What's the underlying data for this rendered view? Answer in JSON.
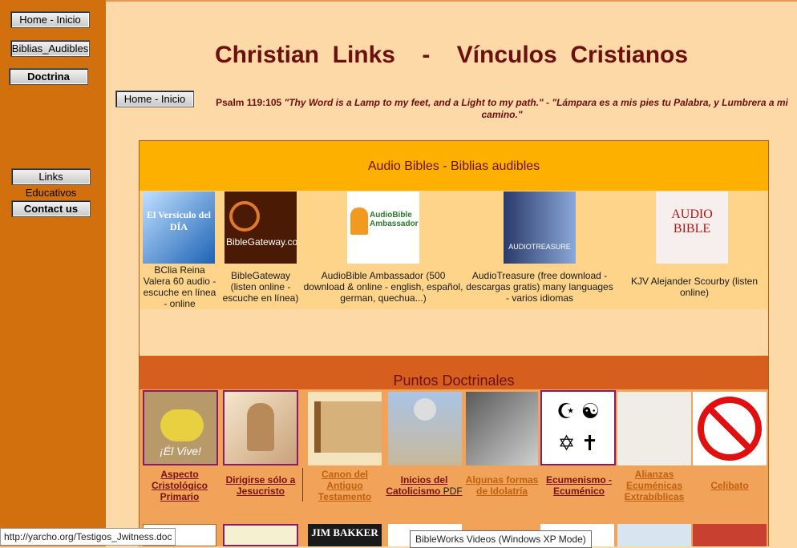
{
  "sidebar": {
    "buttons": [
      {
        "label": "Home - Inicio"
      },
      {
        "label": "Biblias_Audibles"
      },
      {
        "label": "Doctrina"
      },
      {
        "label": "Links Educativos"
      },
      {
        "label": "Contact us"
      }
    ]
  },
  "header": {
    "title": "Christian  Links    -    Vínculos  Cristianos",
    "home_button": "Home - Inicio",
    "psalm_ref": "Psalm 119:105",
    "psalm_text": "\"Thy Word is a Lamp to my feet, and a Light to my path.\" - \"Lámpara es a mis pies tu Palabra, y Lumbrera a mi camino.\""
  },
  "audio_section": {
    "heading": "Audio Bibles - Biblias audibles",
    "items": [
      {
        "thumb_text": "El Versículo del DÍA",
        "caption": "BClia Reina Valera 60 audio - escuche en línea - online"
      },
      {
        "thumb_text": "BibleGateway.com",
        "caption": "BibleGateway (listen online - escuche en línea)"
      },
      {
        "thumb_text": "AudioBible Ambassador",
        "caption": "AudioBible Ambassador (500 download & online - english, español, german, quechua...)"
      },
      {
        "thumb_text": "AUDIOTREASURE",
        "caption": "AudioTreasure (free download - descargas gratis) many languages - varios idiomas"
      },
      {
        "thumb_text": "AUDIO BIBLE",
        "caption": "KJV Alejander Scourby (listen online)"
      }
    ]
  },
  "doctrine_section": {
    "heading": "Puntos Doctrinales",
    "items": [
      {
        "thumb_text": "¡Él Vive!",
        "caption": "Aspecto Cristológico Primario",
        "suffix": ""
      },
      {
        "thumb_text": "",
        "caption": "Dirigirse sólo a Jesucristo",
        "suffix": ""
      },
      {
        "thumb_text": "",
        "caption": "Canon del Antiguo Testamento",
        "suffix": ""
      },
      {
        "thumb_text": "",
        "caption": "Inicios del Catolicismo",
        "suffix": " PDF"
      },
      {
        "thumb_text": "",
        "caption": "Algunas formas de Idolatría",
        "suffix": ""
      },
      {
        "thumb_text": "",
        "caption": "Ecumenismo - Ecuménico",
        "suffix": ""
      },
      {
        "thumb_text": "",
        "caption": "Alianzas Ecuménicas Extrabíblicas",
        "suffix": ""
      },
      {
        "thumb_text": "",
        "caption": "Celibato",
        "suffix": ""
      }
    ],
    "row3_text": "JIM BAKKER"
  },
  "status_bar": {
    "url": "http://yarcho.org/Testigos_Jwitness.doc"
  },
  "tooltip": {
    "text": "BibleWorks Videos (Windows XP Mode)"
  },
  "colors": {
    "sidebar": "#d1700c",
    "page": "#fdd9a8",
    "title": "#6b0f0f",
    "audio_header": "#fdb000",
    "doctrine_header": "#d75f1d"
  }
}
